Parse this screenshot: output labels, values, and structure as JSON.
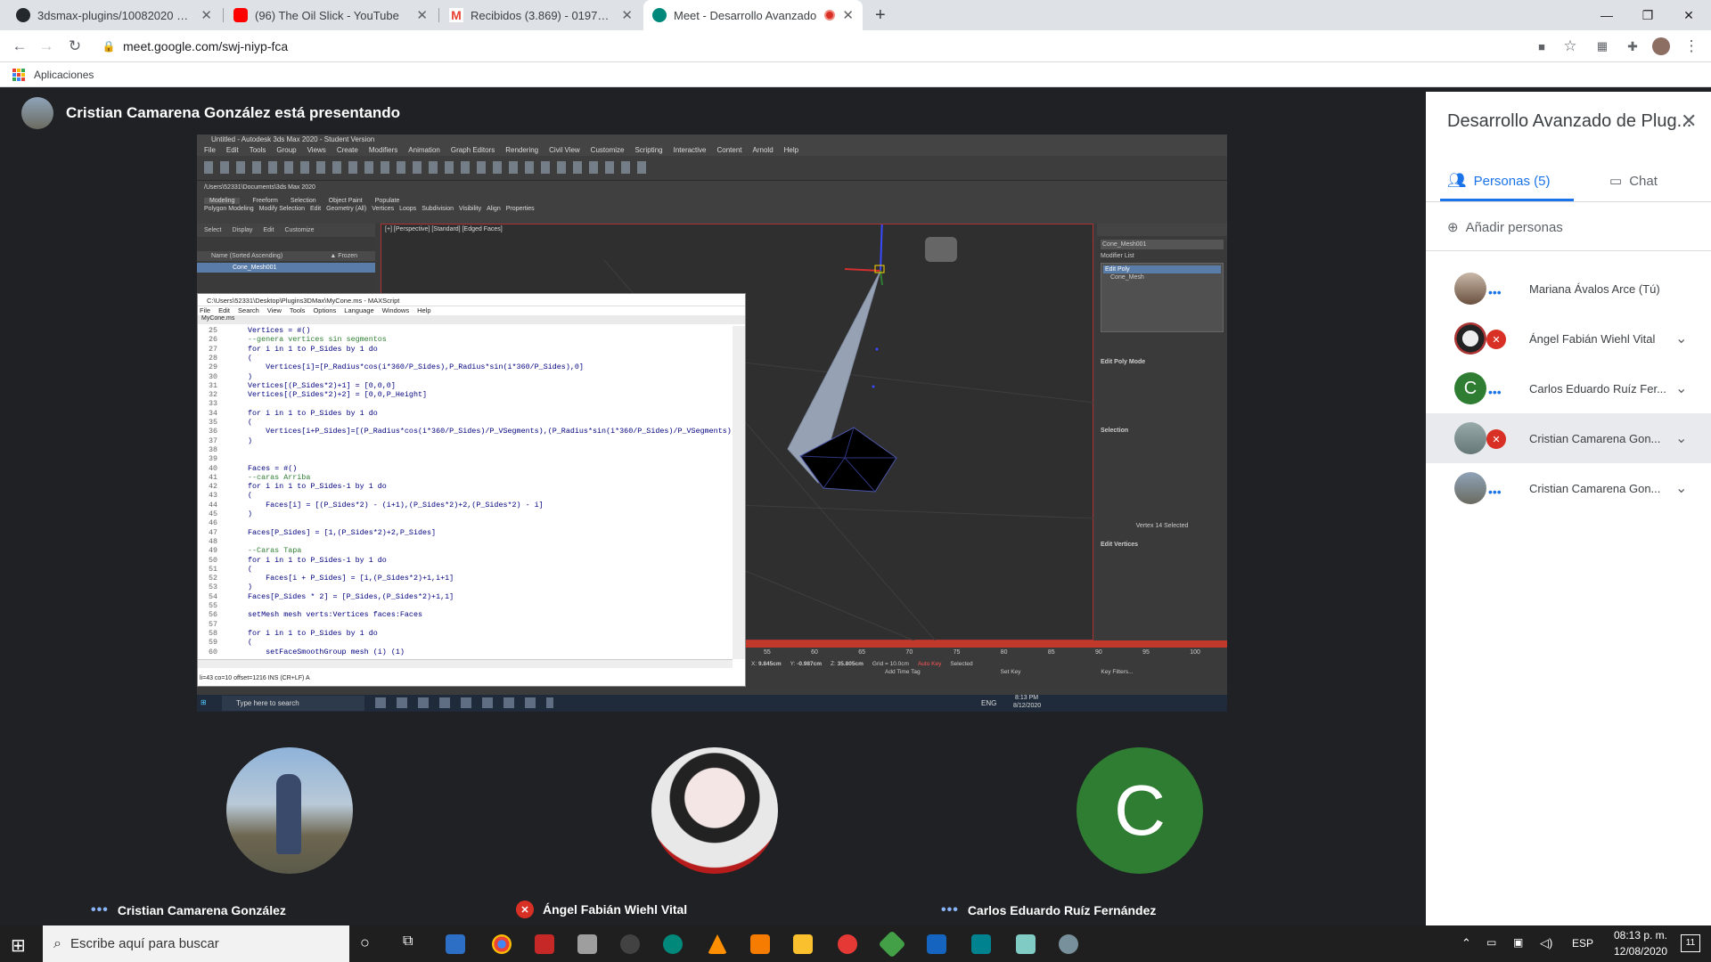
{
  "browser": {
    "tabs": [
      {
        "title": "3dsmax-plugins/10082020 at ma",
        "icon": "github-icon",
        "active": false
      },
      {
        "title": "(96) The Oil Slick - YouTube",
        "icon": "youtube-icon",
        "active": false
      },
      {
        "title": "Recibidos (3.869) - 0197495@up",
        "icon": "gmail-icon",
        "active": false
      },
      {
        "title": "Meet - Desarrollo Avanzado",
        "icon": "meet-icon",
        "active": true
      }
    ],
    "new_tab_label": "+",
    "url": "meet.google.com/swj-niyp-fca",
    "bookmarks_label": "Aplicaciones"
  },
  "meet": {
    "presenting_text": "Cristian Camarena González está presentando",
    "tiles": [
      {
        "name": "Cristian Camarena González",
        "status": "speaking",
        "avatar": "photo"
      },
      {
        "name": "Ángel Fabián Wiehl Vital",
        "status": "muted",
        "avatar": "anime"
      },
      {
        "name": "Carlos Eduardo Ruíz Fernández",
        "status": "speaking",
        "avatar": "letter",
        "letter": "C",
        "color": "#2e7d32"
      }
    ]
  },
  "panel": {
    "title": "Desarrollo Avanzado de Plug...",
    "tab_people": "Personas (5)",
    "tab_chat": "Chat",
    "add_people": "Añadir personas",
    "participants": [
      {
        "name": "Mariana Ávalos Arce (Tú)",
        "status": "dots"
      },
      {
        "name": "Ángel Fabián Wiehl Vital",
        "status": "muted"
      },
      {
        "name": "Carlos Eduardo Ruíz Fer...",
        "status": "dots",
        "letter": "C"
      },
      {
        "name": "Cristian Camarena Gon...",
        "status": "muted",
        "highlight": true
      },
      {
        "name": "Cristian Camarena Gon...",
        "status": "dots"
      }
    ]
  },
  "shared": {
    "max_title": "Untitled - Autodesk 3ds Max 2020 - Student Version",
    "max_menu": [
      "File",
      "Edit",
      "Tools",
      "Group",
      "Views",
      "Create",
      "Modifiers",
      "Animation",
      "Graph Editors",
      "Rendering",
      "Civil View",
      "Customize",
      "Scripting",
      "Interactive",
      "Content",
      "Arnold",
      "Help"
    ],
    "ribbon_tabs": [
      "Modeling",
      "Freeform",
      "Selection",
      "Object Paint",
      "Populate"
    ],
    "ribbon_items": [
      "Polygon Modeling",
      "Modify Selection",
      "Edit",
      "Geometry (All)",
      "Vertices",
      "Loops",
      "Subdivision",
      "Visibility",
      "Align",
      "Properties"
    ],
    "viewport_label": "[+] [Perspective] [Standard] [Edged Faces]",
    "scene_tabs": [
      "Select",
      "Display",
      "Edit",
      "Customize"
    ],
    "scene_header": "Name (Sorted Ascending)",
    "scene_frozen": "▲ Frozen",
    "scene_item": "Cone_Mesh001",
    "object_name": "Cone_Mesh001",
    "modifier_list": "Modifier List",
    "modifiers": [
      "Edit Poly",
      "Cone_Mesh"
    ],
    "edit_poly_mode": "Edit Poly Mode",
    "selection_label": "Selection",
    "vertex_status": "Vertex 14 Selected",
    "edit_vertices": "Edit Vertices",
    "maxscript_title": "C:\\Users\\52331\\Desktop\\Plugins3DMax\\MyCone.ms - MAXScript",
    "maxscript_menu": [
      "File",
      "Edit",
      "Search",
      "View",
      "Tools",
      "Options",
      "Language",
      "Windows",
      "Help"
    ],
    "maxscript_tab": "MyCone.ms",
    "code_lines": [
      {
        "n": "25",
        "t": "Vertices = #()"
      },
      {
        "n": "26",
        "t": "--genera vertices sin segmentos"
      },
      {
        "n": "27",
        "t": "for i in 1 to P_Sides by 1 do"
      },
      {
        "n": "28",
        "t": "("
      },
      {
        "n": "29",
        "t": "    Vertices[i]=[P_Radius*cos(i*360/P_Sides),P_Radius*sin(i*360/P_Sides),0]"
      },
      {
        "n": "30",
        "t": ")"
      },
      {
        "n": "31",
        "t": "Vertices[(P_Sides*2)+1] = [0,0,0]"
      },
      {
        "n": "32",
        "t": "Vertices[(P_Sides*2)+2] = [0,0,P_Height]"
      },
      {
        "n": "33",
        "t": ""
      },
      {
        "n": "34",
        "t": "for i in 1 to P_Sides by 1 do"
      },
      {
        "n": "35",
        "t": "("
      },
      {
        "n": "36",
        "t": "    Vertices[i+P_Sides]=[(P_Radius*cos(i*360/P_Sides)/P_VSegments),(P_Radius*sin(i*360/P_Sides)/P_VSegments),(P_Height/P_VS"
      },
      {
        "n": "37",
        "t": ")"
      },
      {
        "n": "38",
        "t": ""
      },
      {
        "n": "39",
        "t": ""
      },
      {
        "n": "40",
        "t": "Faces = #()"
      },
      {
        "n": "41",
        "t": "--caras Arriba"
      },
      {
        "n": "42",
        "t": "for i in 1 to P_Sides-1 by 1 do"
      },
      {
        "n": "43",
        "t": "("
      },
      {
        "n": "44",
        "t": "    Faces[i] = [(P_Sides*2) - (i+1),(P_Sides*2)+2,(P_Sides*2) - i]"
      },
      {
        "n": "45",
        "t": ")"
      },
      {
        "n": "46",
        "t": ""
      },
      {
        "n": "47",
        "t": "Faces[P_Sides] = [1,(P_Sides*2)+2,P_Sides]"
      },
      {
        "n": "48",
        "t": ""
      },
      {
        "n": "49",
        "t": "--Caras Tapa"
      },
      {
        "n": "50",
        "t": "for i in 1 to P_Sides-1 by 1 do"
      },
      {
        "n": "51",
        "t": "("
      },
      {
        "n": "52",
        "t": "    Faces[i + P_Sides] = [i,(P_Sides*2)+1,i+1]"
      },
      {
        "n": "53",
        "t": ")"
      },
      {
        "n": "54",
        "t": "Faces[P_Sides * 2] = [P_Sides,(P_Sides*2)+1,1]"
      },
      {
        "n": "55",
        "t": ""
      },
      {
        "n": "56",
        "t": "setMesh mesh verts:Vertices faces:Faces"
      },
      {
        "n": "57",
        "t": ""
      },
      {
        "n": "58",
        "t": "for i in 1 to P_Sides by 1 do"
      },
      {
        "n": "59",
        "t": "("
      },
      {
        "n": "60",
        "t": "    setFaceSmoothGroup mesh (i) (1)"
      }
    ],
    "maxscript_status": "li=43 co=10 offset=1216 INS (CR+LF) A",
    "timeline_ticks": [
      "55",
      "60",
      "65",
      "70",
      "75",
      "80",
      "85",
      "90",
      "95",
      "100"
    ],
    "coords": {
      "x": "9.845cm",
      "y": "-0.987cm",
      "z": "35.805cm",
      "grid": "Grid = 10.0cm"
    },
    "add_time_tag": "Add Time Tag",
    "auto_key": "Auto Key",
    "selected": "Selected",
    "set_key": "Set Key",
    "key_filters": "Key Filters...",
    "inner_search": "Type here to search",
    "inner_clock": "8:13 PM",
    "inner_date": "8/12/2020",
    "inner_lang": "ENG"
  },
  "taskbar": {
    "search_placeholder": "Escribe aquí para buscar",
    "lang": "ESP",
    "time": "08:13 p. m.",
    "date": "12/08/2020",
    "notifications": "11"
  }
}
